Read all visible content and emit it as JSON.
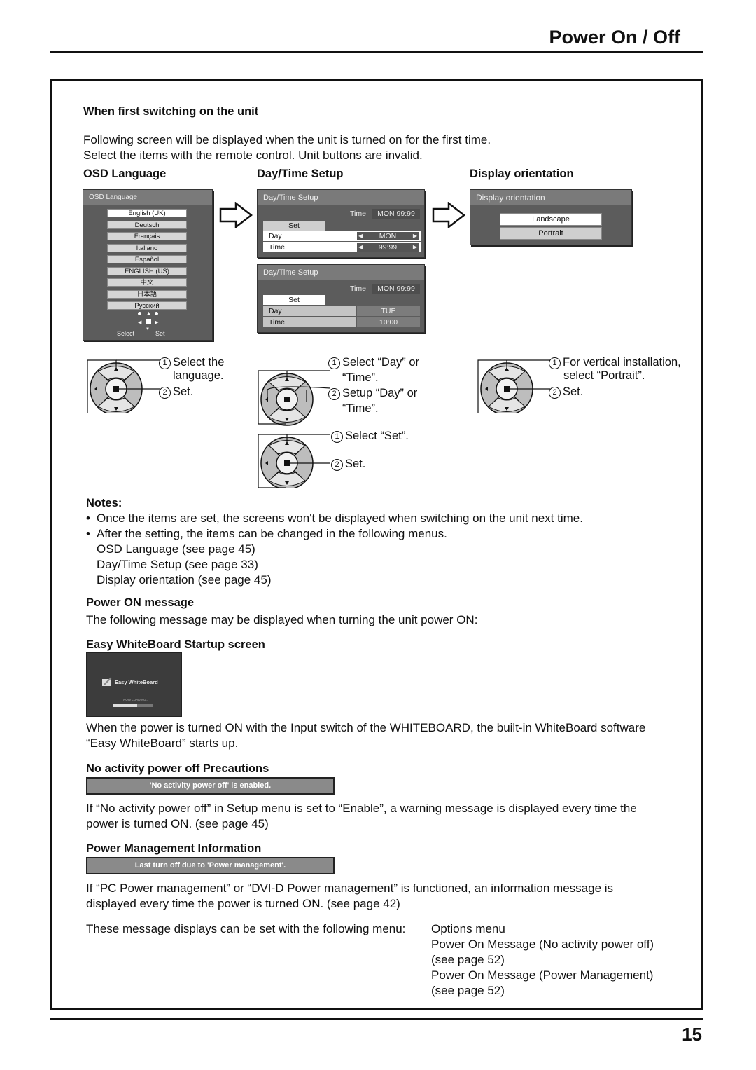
{
  "page": {
    "title": "Power On / Off",
    "page_number": "15"
  },
  "first_switch": {
    "heading": "When first switching on the unit",
    "line1": "Following screen will be displayed when the unit is turned on for the first time.",
    "line2": "Select the items with the remote control. Unit buttons are invalid."
  },
  "osd_language": {
    "heading": "OSD Language",
    "panel_title": "OSD Language",
    "options": [
      "English (UK)",
      "Deutsch",
      "Français",
      "Italiano",
      "Español",
      "ENGLISH (US)",
      "中文",
      "日本語",
      "Русский"
    ],
    "selected": "English (UK)",
    "hint_select": "Select",
    "hint_set": "Set",
    "step1_num": "1",
    "step1": "Select the",
    "step1b": "language.",
    "step2_num": "2",
    "step2": "Set."
  },
  "day_time": {
    "heading": "Day/Time Setup",
    "panel1": {
      "title": "Day/Time Setup",
      "time_label": "Time",
      "time_value": "MON  99:99",
      "set_label": "Set",
      "day_label": "Day",
      "day_value": "MON",
      "time_row_label": "Time",
      "time_row_value": "99:99"
    },
    "panel2": {
      "title": "Day/Time Setup",
      "time_label": "Time",
      "time_value": "MON  99:99",
      "set_label": "Set",
      "day_label": "Day",
      "day_value": "TUE",
      "time_row_label": "Time",
      "time_row_value": "10:00"
    },
    "stepA1_num": "1",
    "stepA1": "Select “Day” or",
    "stepA1b": "“Time”.",
    "stepA2_num": "2",
    "stepA2": "Setup “Day” or",
    "stepA2b": "“Time”.",
    "stepB1_num": "1",
    "stepB1": "Select “Set”.",
    "stepB2_num": "2",
    "stepB2": "Set."
  },
  "orientation": {
    "heading": "Display orientation",
    "panel_title": "Display orientation",
    "options": [
      "Landscape",
      "Portrait"
    ],
    "selected": "Landscape",
    "step1_num": "1",
    "step1": "For vertical installation,",
    "step1b": "select “Portrait”.",
    "step2_num": "2",
    "step2": "Set."
  },
  "notes": {
    "heading": "Notes:",
    "bullets": [
      "Once the items are set, the screens won't be displayed when switching on the unit next time.",
      "After the setting, the items can be changed in the following menus."
    ],
    "refs": [
      "OSD Language (see page 45)",
      "Day/Time Setup (see page 33)",
      "Display orientation (see page 45)"
    ]
  },
  "power_on_message": {
    "heading": "Power ON message",
    "text": "The following message may be displayed when turning the unit power ON:"
  },
  "whiteboard": {
    "heading": "Easy WhiteBoard Startup screen",
    "splash_title": "Easy WhiteBoard",
    "splash_status": "NOW LOADING...",
    "loading_progress": 0.6,
    "text1": "When the power is turned ON with the Input switch of the WHITEBOARD, the built-in WhiteBoard software",
    "text2": "“Easy WhiteBoard” starts up."
  },
  "no_activity": {
    "heading": "No activity power off Precautions",
    "message": "'No activity power off' is enabled.",
    "text1": "If “No activity power off” in Setup menu is set to “Enable”, a warning message is displayed every time the",
    "text2": "power is turned ON. (see page 45)"
  },
  "power_mgmt": {
    "heading": "Power Management Information",
    "message": "Last turn off due to 'Power management'.",
    "text1": "If “PC Power management” or “DVI-D Power management” is functioned, an information message is",
    "text2": "displayed every time the power is turned ON. (see page 42)"
  },
  "menu_settings": {
    "lead": "These message displays can be set with the following menu:",
    "lines": [
      "Options menu",
      "Power On Message (No activity power off)",
      "(see page 52)",
      "Power On Message (Power Management)",
      "(see page 52)"
    ]
  }
}
